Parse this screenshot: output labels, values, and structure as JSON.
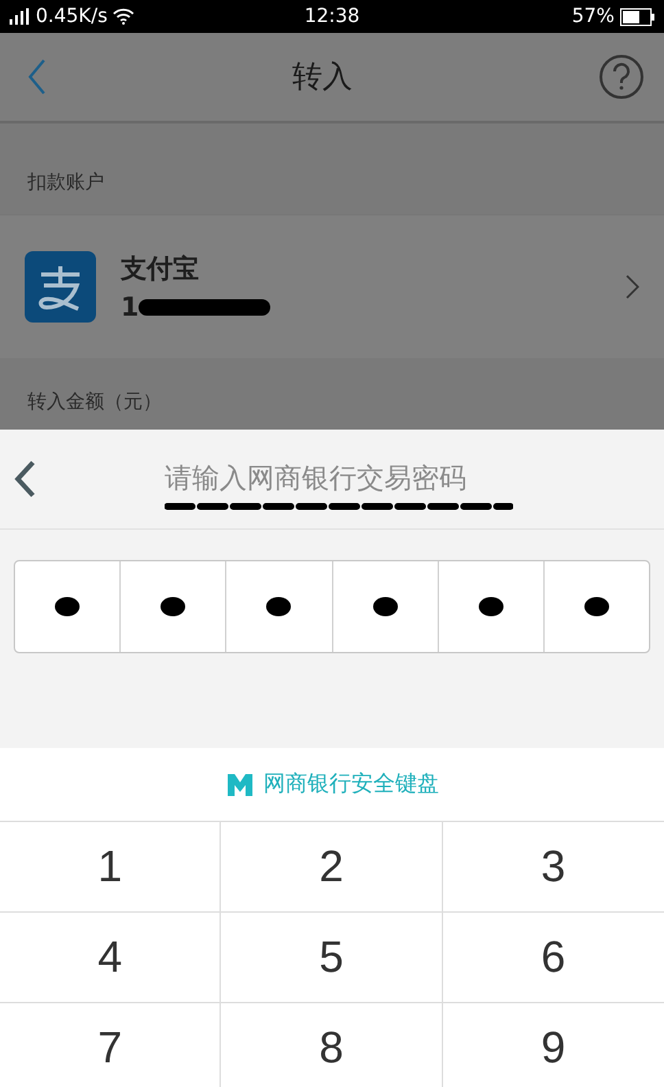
{
  "status_bar": {
    "network": "0.45K/s",
    "time": "12:38",
    "battery": "57%"
  },
  "header": {
    "title": "转入"
  },
  "payment_section": {
    "label": "扣款账户",
    "account_name": "支付宝",
    "account_number": "1"
  },
  "amount_section": {
    "label": "转入金额（元）"
  },
  "password_sheet": {
    "title": "请输入网商银行交易密码",
    "digits": [
      {
        "filled": true
      },
      {
        "filled": true
      },
      {
        "filled": true
      },
      {
        "filled": true
      },
      {
        "filled": true
      },
      {
        "filled": true
      }
    ]
  },
  "keyboard": {
    "brand": "网商银行安全键盘",
    "keys": [
      "1",
      "2",
      "3",
      "4",
      "5",
      "6",
      "7",
      "8",
      "9"
    ]
  }
}
